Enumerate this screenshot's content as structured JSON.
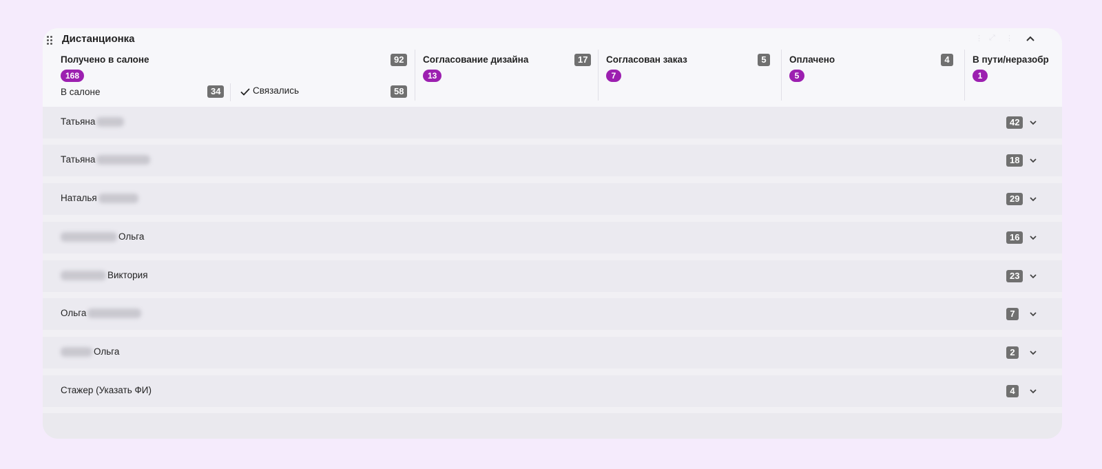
{
  "widget": {
    "title": "Дистанционка"
  },
  "stages": [
    {
      "title": "Получено в салоне",
      "count": "92",
      "badge": "168"
    },
    {
      "title": "Согласование дизайна",
      "count": "17",
      "badge": "13"
    },
    {
      "title": "Согласован заказ",
      "count": "5",
      "badge": "7"
    },
    {
      "title": "Оплачено",
      "count": "4",
      "badge": "5"
    },
    {
      "title": "В пути/неразобр",
      "count": "",
      "badge": "1"
    }
  ],
  "substages": [
    {
      "label": "В салоне",
      "count": "34"
    },
    {
      "label": "Связались",
      "count": "58"
    }
  ],
  "rows": [
    {
      "name_first": "Татьяна",
      "name_last": "",
      "count": "42"
    },
    {
      "name_first": "Татьяна",
      "name_last": "",
      "count": "18"
    },
    {
      "name_first": "Наталья",
      "name_last": "",
      "count": "29"
    },
    {
      "name_first": "",
      "name_last": "Ольга",
      "count": "16"
    },
    {
      "name_first": "",
      "name_last": "Виктория",
      "count": "23"
    },
    {
      "name_first": "Ольга",
      "name_last": "",
      "count": "7"
    },
    {
      "name_first": "",
      "name_last": "Ольга",
      "count": "2"
    },
    {
      "name_first": "Стажер (Указать ФИ)",
      "name_last": "",
      "count": "4"
    }
  ],
  "colors": {
    "page_background": "#f5ebfc",
    "badge_purple": "#9c1fb0",
    "count_grey": "#707070"
  },
  "icons": {
    "drag": "drag-handle-icon",
    "collapse": "chevron-up-icon",
    "expand": "chevron-down-icon",
    "check": "check-icon"
  }
}
